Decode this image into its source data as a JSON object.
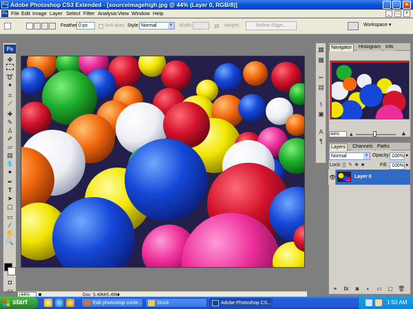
{
  "window": {
    "title": "Adobe Photoshop CS3 Extended - [sourceimagehigh.jpg @ 44% (Layer 0, RGB/8)]",
    "app_icon": "Ps",
    "buttons": [
      "_",
      "□",
      "×"
    ]
  },
  "menu": [
    "File",
    "Edit",
    "Image",
    "Layer",
    "Select",
    "Filter",
    "Analysis",
    "View",
    "Window",
    "Help"
  ],
  "doc_window_controls": [
    "_",
    "□",
    "×"
  ],
  "options": {
    "feather_label": "Feather:",
    "feather_value": "0 px",
    "antialias_label": "Anti-alias",
    "style_label": "Style:",
    "style_value": "Normal",
    "width_label": "Width:",
    "height_label": "Height:",
    "refine_label": "Refine Edge...",
    "workspace_label": "Workspace ▾"
  },
  "tools": {
    "logo": "Ps",
    "icons": [
      "move-tool",
      "marquee-tool",
      "lasso-tool",
      "magic-wand-tool",
      "crop-tool",
      "slice-tool",
      "healing-brush-tool",
      "brush-tool",
      "clone-stamp-tool",
      "history-brush-tool",
      "eraser-tool",
      "gradient-tool",
      "blur-tool",
      "dodge-tool",
      "pen-tool",
      "type-tool",
      "path-selection-tool",
      "shape-tool",
      "notes-tool",
      "eyedropper-tool",
      "hand-tool",
      "zoom-tool"
    ]
  },
  "document": {
    "zoom": "44%",
    "info": "Doc: 5.49M/5.49M"
  },
  "navigator": {
    "tabs": [
      "Navigator",
      "Histogram",
      "Info"
    ],
    "zoom": "44%"
  },
  "layers": {
    "tabs": [
      "Layers",
      "Channels",
      "Paths"
    ],
    "blend_mode": "Normal",
    "opacity_label": "Opacity:",
    "opacity_value": "100%",
    "lock_label": "Lock:",
    "fill_label": "Fill:",
    "fill_value": "100%",
    "layer_name": "Layer 0",
    "bottom_icons": [
      "link-icon",
      "fx-icon",
      "mask-icon",
      "adjustment-icon",
      "folder-icon",
      "new-layer-icon",
      "trash-icon"
    ]
  },
  "taskbar": {
    "start_label": "start",
    "tasks": [
      {
        "label": "Edit photoshop conte...",
        "active": false
      },
      {
        "label": "Stock",
        "active": false
      },
      {
        "label": "Adobe Photoshop CS...",
        "active": true
      }
    ],
    "clock": "1:50 AM"
  },
  "colors": {
    "title_blue": "#0a55d6",
    "panel_gray": "#d4d0c8",
    "selection_blue": "#316ac5",
    "start_green": "#2f9a2f"
  }
}
